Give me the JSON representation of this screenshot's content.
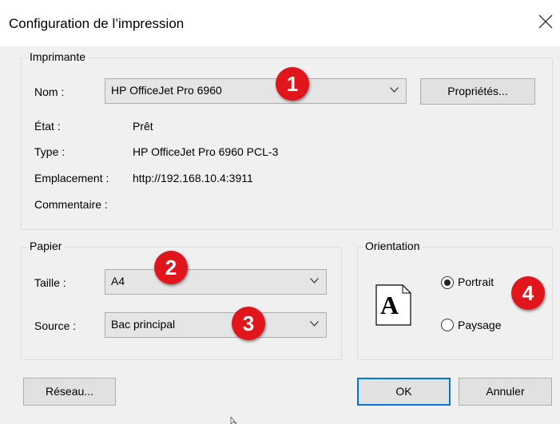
{
  "window": {
    "title": "Configuration de l’impression"
  },
  "printer": {
    "legend": "Imprimante",
    "name_label": "Nom :",
    "name_value": "HP OfficeJet Pro 6960",
    "properties_button": "Propriétés...",
    "state_label": "État :",
    "state_value": "Prêt",
    "type_label": "Type :",
    "type_value": "HP OfficeJet Pro 6960 PCL-3",
    "location_label": "Emplacement :",
    "location_value": "http://192.168.10.4:3911",
    "comment_label": "Commentaire :"
  },
  "paper": {
    "legend": "Papier",
    "size_label": "Taille :",
    "size_value": "A4",
    "source_label": "Source :",
    "source_value": "Bac principal"
  },
  "orientation": {
    "legend": "Orientation",
    "portrait_label": "Portrait",
    "landscape_label": "Paysage",
    "selected": "Portrait",
    "preview_letter": "A"
  },
  "buttons": {
    "network": "Réseau...",
    "ok": "OK",
    "cancel": "Annuler"
  },
  "annotations": {
    "badge1": "1",
    "badge2": "2",
    "badge3": "3",
    "badge4": "4",
    "badge_color": "#e0161c"
  },
  "icons": [
    "close-icon",
    "chevron-down-icon",
    "page-preview-icon",
    "radio-icon"
  ]
}
